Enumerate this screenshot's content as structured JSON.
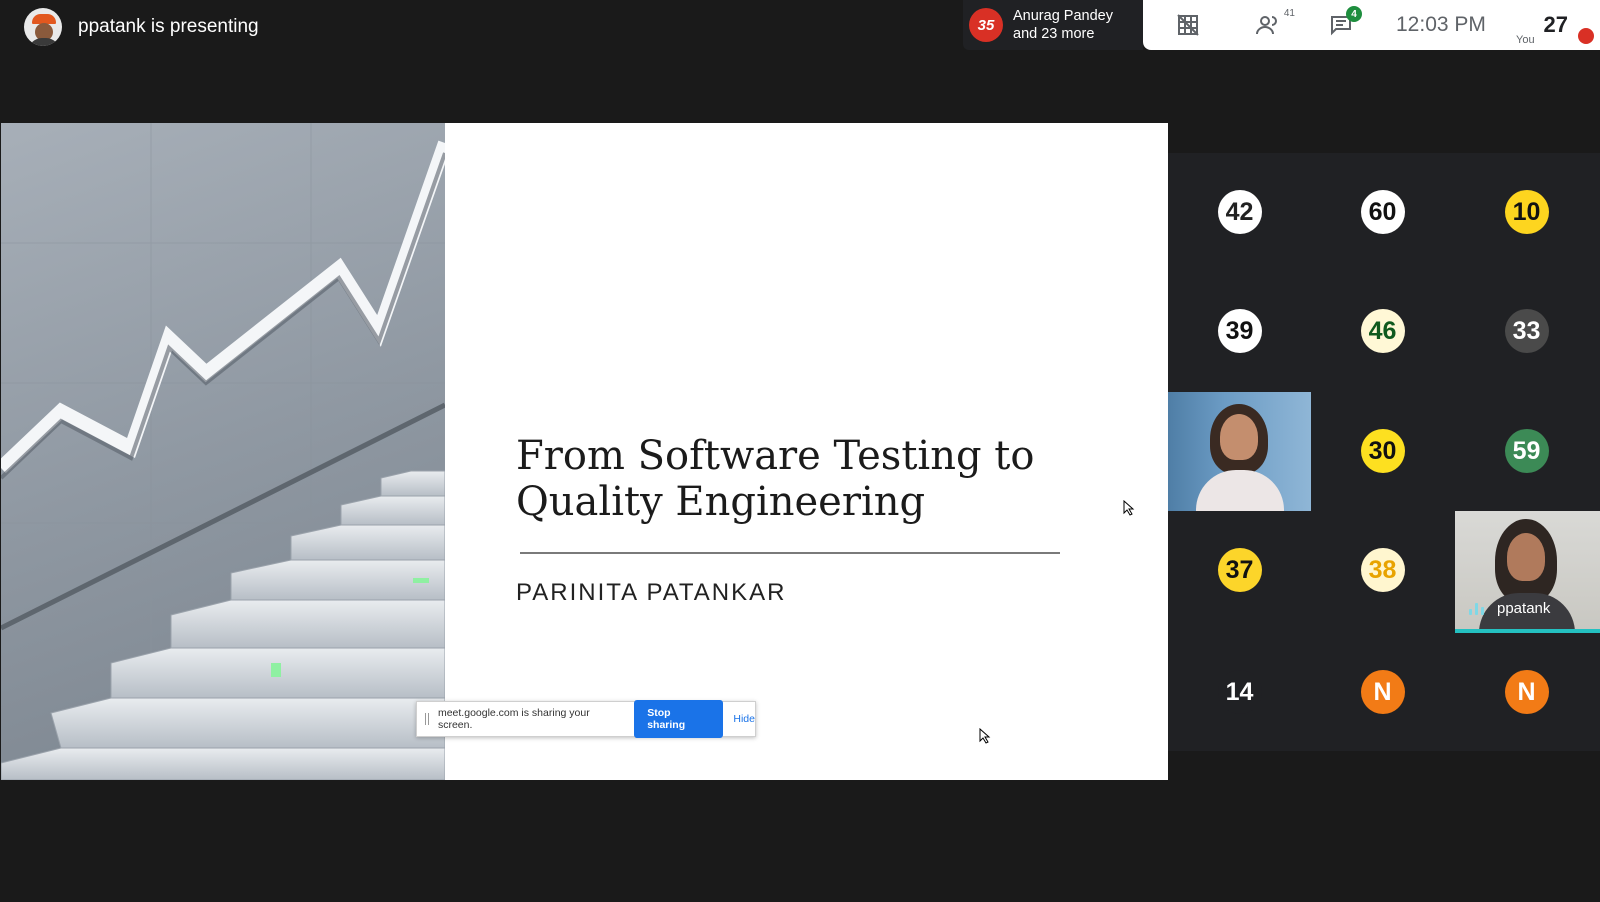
{
  "presenter": {
    "text": "ppatank is presenting"
  },
  "active_speakers": {
    "badge": "35",
    "line1": "Anurag Pandey",
    "line2": "and 23 more"
  },
  "toolbar": {
    "people_count": "41",
    "chat_badge": "4",
    "time": "12:03 PM",
    "self_tile": {
      "number": "27",
      "label": "You"
    }
  },
  "slide": {
    "title_line1": "From Software Testing to",
    "title_line2": "Quality Engineering",
    "author": "PARINITA PATANKAR"
  },
  "share_bar": {
    "message": "meet.google.com is sharing your screen.",
    "stop": "Stop sharing",
    "hide": "Hide"
  },
  "participants": [
    {
      "label": "42",
      "bg": "#ffffff",
      "fg": "#222222"
    },
    {
      "label": "60",
      "bg": "#ffffff",
      "fg": "#111111"
    },
    {
      "label": "10",
      "bg": "#fdd51f",
      "fg": "#111111"
    },
    {
      "label": "39",
      "bg": "#ffffff",
      "fg": "#111111"
    },
    {
      "label": "46",
      "bg": "#fff8d6",
      "fg": "#0f5a1e"
    },
    {
      "label": "33",
      "bg": "#4a4a4a",
      "fg": "#ffffff"
    },
    {
      "label": "30",
      "bg": "#fde020",
      "fg": "#111111"
    },
    {
      "label": "59",
      "bg": "#3c8a56",
      "fg": "#ffffff"
    },
    {
      "label": "37",
      "bg": "#fcd52a",
      "fg": "#111111"
    },
    {
      "label": "38",
      "bg": "#fff6cf",
      "fg": "#e8a300"
    },
    {
      "label": "14",
      "bg": "#202124",
      "fg": "#ffffff"
    },
    {
      "label": "N",
      "bg": "#f27b16",
      "fg": "#ffffff"
    },
    {
      "label": "N",
      "bg": "#f27b16",
      "fg": "#ffffff"
    }
  ],
  "video_tiles": [
    {
      "name": ""
    },
    {
      "name": "ppatank"
    }
  ]
}
